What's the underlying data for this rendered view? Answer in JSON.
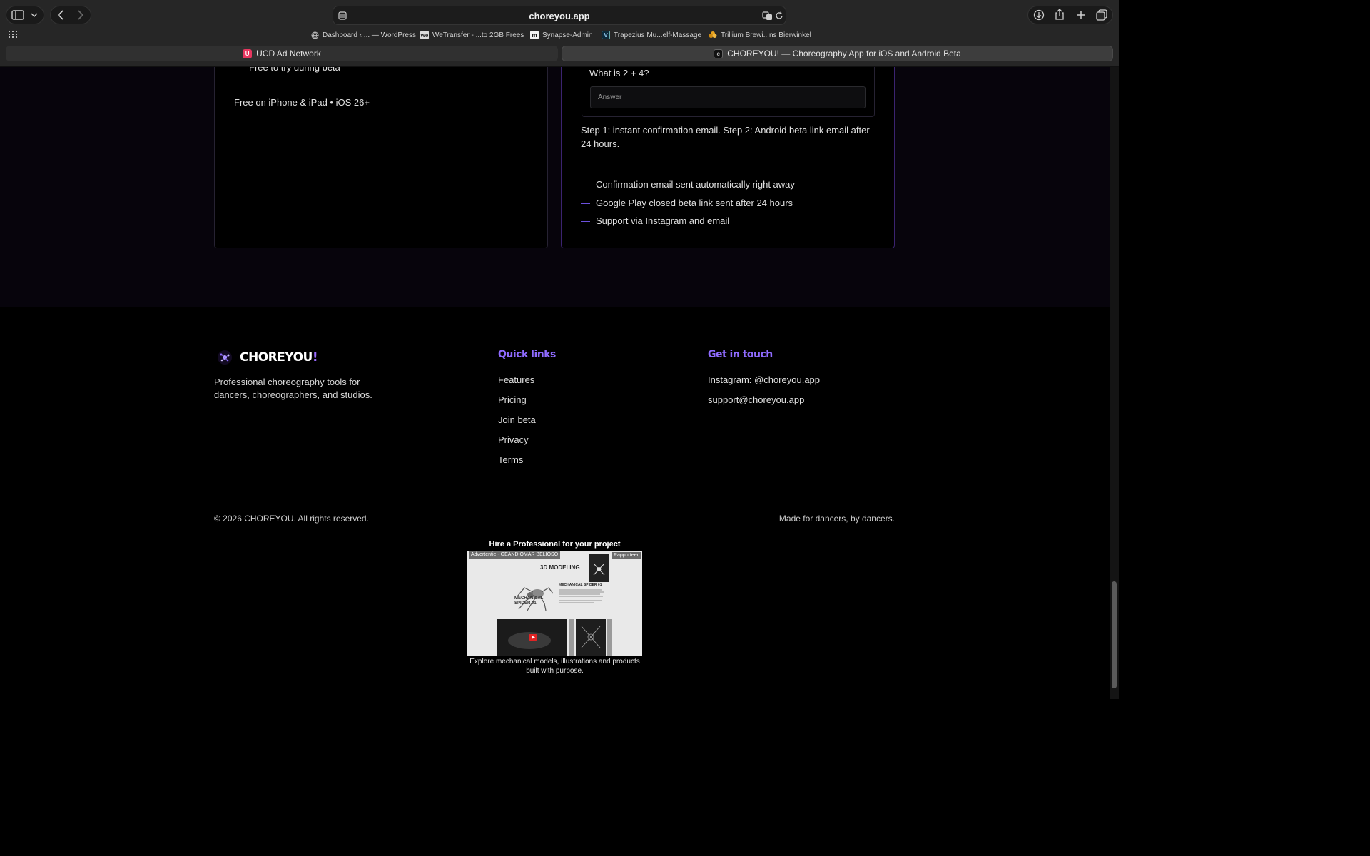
{
  "browser": {
    "url": "choreyou.app",
    "bookmarks": [
      {
        "label": "Dashboard ‹ ... — WordPress",
        "icon": "globe-icon"
      },
      {
        "label": "WeTransfer - ...to 2GB Frees",
        "icon": "wetransfer-icon",
        "glyph": "we"
      },
      {
        "label": "Synapse-Admin",
        "icon": "synapse-icon",
        "glyph": "m"
      },
      {
        "label": "Trapezius Mu...elf-Massage",
        "icon": "trapezius-icon",
        "glyph": "V"
      },
      {
        "label": "Trillium Brewi...ns Bierwinkel",
        "icon": "trillium-icon"
      }
    ],
    "tabs": [
      {
        "title": "UCD Ad Network",
        "icon_glyph": "U",
        "active": false
      },
      {
        "title": "CHOREYOU! — Choreography App for iOS and Android Beta",
        "icon_glyph": "c",
        "active": true
      }
    ]
  },
  "pricing": {
    "left_bullets": [
      "Free to try during beta"
    ],
    "left_note": "Free on iPhone & iPad • iOS 26+",
    "captcha_question": "What is 2 + 4?",
    "answer_placeholder": "Answer",
    "steps_text": "Step 1: instant confirmation email. Step 2: Android beta link email after 24 hours.",
    "right_bullets": [
      "Confirmation email sent automatically right away",
      "Google Play closed beta link sent after 24 hours",
      "Support via Instagram and email"
    ],
    "accent": "#7c5cff"
  },
  "footer": {
    "brand": "CHOREYOU",
    "brand_bang": "!",
    "tagline": "Professional choreography tools for dancers, choreographers, and studios.",
    "quick_links_title": "Quick links",
    "quick_links": [
      "Features",
      "Pricing",
      "Join beta",
      "Privacy",
      "Terms"
    ],
    "contact_title": "Get in touch",
    "contact": [
      "Instagram: @choreyou.app",
      "support@choreyou.app"
    ],
    "copyright": "© 2026 CHOREYOU. All rights reserved.",
    "made_for": "Made for dancers, by dancers.",
    "title_color": "#8f6bff"
  },
  "ad": {
    "title": "Hire a Professional for your project",
    "tag": "Advertentie - GEANDIOMAR BELIOSO",
    "report": "Rapporteer",
    "heading": "3D MODELING",
    "subheading": "MECHANICAL SPIDER 01",
    "side_label": "MECHANICAL SPIDER 01",
    "caption": "Explore mechanical models, illustrations and products built with purpose."
  }
}
